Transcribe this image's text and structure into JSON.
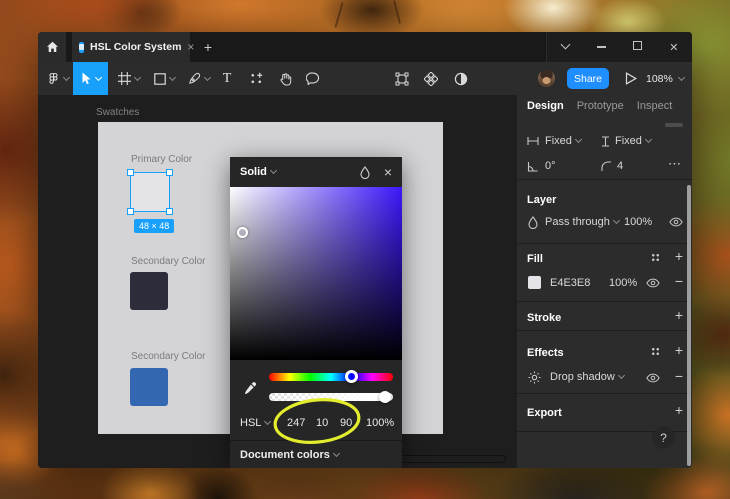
{
  "titlebar": {
    "tab_title": "HSL Color System",
    "close_tab_glyph": "×",
    "new_tab_glyph": "+"
  },
  "toolbar": {
    "text_tool_glyph": "T",
    "share_label": "Share",
    "zoom_level": "108%",
    "accent_color": "#18a0fb",
    "share_color": "#1f8fff"
  },
  "canvas": {
    "frame_label": "Swatches",
    "swatches": [
      {
        "label": "Primary Color",
        "color": "#E4E3E8",
        "size_badge": "48 × 48"
      },
      {
        "label": "Secondary Color",
        "color": "#2C2C3A"
      },
      {
        "label": "Secondary Color",
        "color": "#3467B2"
      }
    ]
  },
  "color_picker": {
    "fill_type": "Solid",
    "close_glyph": "×",
    "mode": "HSL",
    "h": "247",
    "s": "10",
    "l": "90",
    "alpha": "100%",
    "document_colors": "Document colors",
    "hue_hex": "#3C17FA",
    "annotation_color": "#e4ec2e"
  },
  "panel": {
    "tabs": [
      "Design",
      "Prototype",
      "Inspect"
    ],
    "constraint_h": "Fixed",
    "constraint_v": "Fixed",
    "rotation": "0°",
    "corner_radius": "4",
    "more_glyph": "⋯",
    "plus_glyph": "+",
    "minus_glyph": "−",
    "layer": {
      "title": "Layer",
      "blend_mode": "Pass through",
      "opacity": "100%"
    },
    "fill": {
      "title": "Fill",
      "hex": "E4E3E8",
      "opacity": "100%",
      "swatch_color": "#E4E3E8"
    },
    "stroke": {
      "title": "Stroke"
    },
    "effects": {
      "title": "Effects",
      "effect_name": "Drop shadow"
    },
    "export_section": {
      "title": "Export"
    },
    "help_glyph": "?"
  }
}
